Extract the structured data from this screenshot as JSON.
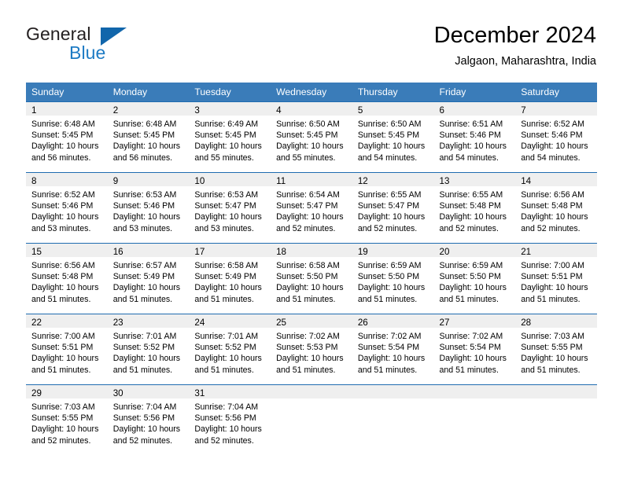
{
  "logo": {
    "word_one": "General",
    "word_two": "Blue",
    "mark": "triangle-logo-mark"
  },
  "header": {
    "title": "December 2024",
    "location": "Jalgaon, Maharashtra, India"
  },
  "colors": {
    "header_blue": "#3a7cb9",
    "row_rule_blue": "#1f6cb0",
    "daynum_band": "#efefef",
    "logo_blue": "#1e7bc4",
    "logo_dark": "#231f20"
  },
  "weekday_headers": [
    "Sunday",
    "Monday",
    "Tuesday",
    "Wednesday",
    "Thursday",
    "Friday",
    "Saturday"
  ],
  "weeks": [
    [
      {
        "day": "1",
        "sunrise": "Sunrise: 6:48 AM",
        "sunset": "Sunset: 5:45 PM",
        "daylight": "Daylight: 10 hours and 56 minutes."
      },
      {
        "day": "2",
        "sunrise": "Sunrise: 6:48 AM",
        "sunset": "Sunset: 5:45 PM",
        "daylight": "Daylight: 10 hours and 56 minutes."
      },
      {
        "day": "3",
        "sunrise": "Sunrise: 6:49 AM",
        "sunset": "Sunset: 5:45 PM",
        "daylight": "Daylight: 10 hours and 55 minutes."
      },
      {
        "day": "4",
        "sunrise": "Sunrise: 6:50 AM",
        "sunset": "Sunset: 5:45 PM",
        "daylight": "Daylight: 10 hours and 55 minutes."
      },
      {
        "day": "5",
        "sunrise": "Sunrise: 6:50 AM",
        "sunset": "Sunset: 5:45 PM",
        "daylight": "Daylight: 10 hours and 54 minutes."
      },
      {
        "day": "6",
        "sunrise": "Sunrise: 6:51 AM",
        "sunset": "Sunset: 5:46 PM",
        "daylight": "Daylight: 10 hours and 54 minutes."
      },
      {
        "day": "7",
        "sunrise": "Sunrise: 6:52 AM",
        "sunset": "Sunset: 5:46 PM",
        "daylight": "Daylight: 10 hours and 54 minutes."
      }
    ],
    [
      {
        "day": "8",
        "sunrise": "Sunrise: 6:52 AM",
        "sunset": "Sunset: 5:46 PM",
        "daylight": "Daylight: 10 hours and 53 minutes."
      },
      {
        "day": "9",
        "sunrise": "Sunrise: 6:53 AM",
        "sunset": "Sunset: 5:46 PM",
        "daylight": "Daylight: 10 hours and 53 minutes."
      },
      {
        "day": "10",
        "sunrise": "Sunrise: 6:53 AM",
        "sunset": "Sunset: 5:47 PM",
        "daylight": "Daylight: 10 hours and 53 minutes."
      },
      {
        "day": "11",
        "sunrise": "Sunrise: 6:54 AM",
        "sunset": "Sunset: 5:47 PM",
        "daylight": "Daylight: 10 hours and 52 minutes."
      },
      {
        "day": "12",
        "sunrise": "Sunrise: 6:55 AM",
        "sunset": "Sunset: 5:47 PM",
        "daylight": "Daylight: 10 hours and 52 minutes."
      },
      {
        "day": "13",
        "sunrise": "Sunrise: 6:55 AM",
        "sunset": "Sunset: 5:48 PM",
        "daylight": "Daylight: 10 hours and 52 minutes."
      },
      {
        "day": "14",
        "sunrise": "Sunrise: 6:56 AM",
        "sunset": "Sunset: 5:48 PM",
        "daylight": "Daylight: 10 hours and 52 minutes."
      }
    ],
    [
      {
        "day": "15",
        "sunrise": "Sunrise: 6:56 AM",
        "sunset": "Sunset: 5:48 PM",
        "daylight": "Daylight: 10 hours and 51 minutes."
      },
      {
        "day": "16",
        "sunrise": "Sunrise: 6:57 AM",
        "sunset": "Sunset: 5:49 PM",
        "daylight": "Daylight: 10 hours and 51 minutes."
      },
      {
        "day": "17",
        "sunrise": "Sunrise: 6:58 AM",
        "sunset": "Sunset: 5:49 PM",
        "daylight": "Daylight: 10 hours and 51 minutes."
      },
      {
        "day": "18",
        "sunrise": "Sunrise: 6:58 AM",
        "sunset": "Sunset: 5:50 PM",
        "daylight": "Daylight: 10 hours and 51 minutes."
      },
      {
        "day": "19",
        "sunrise": "Sunrise: 6:59 AM",
        "sunset": "Sunset: 5:50 PM",
        "daylight": "Daylight: 10 hours and 51 minutes."
      },
      {
        "day": "20",
        "sunrise": "Sunrise: 6:59 AM",
        "sunset": "Sunset: 5:50 PM",
        "daylight": "Daylight: 10 hours and 51 minutes."
      },
      {
        "day": "21",
        "sunrise": "Sunrise: 7:00 AM",
        "sunset": "Sunset: 5:51 PM",
        "daylight": "Daylight: 10 hours and 51 minutes."
      }
    ],
    [
      {
        "day": "22",
        "sunrise": "Sunrise: 7:00 AM",
        "sunset": "Sunset: 5:51 PM",
        "daylight": "Daylight: 10 hours and 51 minutes."
      },
      {
        "day": "23",
        "sunrise": "Sunrise: 7:01 AM",
        "sunset": "Sunset: 5:52 PM",
        "daylight": "Daylight: 10 hours and 51 minutes."
      },
      {
        "day": "24",
        "sunrise": "Sunrise: 7:01 AM",
        "sunset": "Sunset: 5:52 PM",
        "daylight": "Daylight: 10 hours and 51 minutes."
      },
      {
        "day": "25",
        "sunrise": "Sunrise: 7:02 AM",
        "sunset": "Sunset: 5:53 PM",
        "daylight": "Daylight: 10 hours and 51 minutes."
      },
      {
        "day": "26",
        "sunrise": "Sunrise: 7:02 AM",
        "sunset": "Sunset: 5:54 PM",
        "daylight": "Daylight: 10 hours and 51 minutes."
      },
      {
        "day": "27",
        "sunrise": "Sunrise: 7:02 AM",
        "sunset": "Sunset: 5:54 PM",
        "daylight": "Daylight: 10 hours and 51 minutes."
      },
      {
        "day": "28",
        "sunrise": "Sunrise: 7:03 AM",
        "sunset": "Sunset: 5:55 PM",
        "daylight": "Daylight: 10 hours and 51 minutes."
      }
    ],
    [
      {
        "day": "29",
        "sunrise": "Sunrise: 7:03 AM",
        "sunset": "Sunset: 5:55 PM",
        "daylight": "Daylight: 10 hours and 52 minutes."
      },
      {
        "day": "30",
        "sunrise": "Sunrise: 7:04 AM",
        "sunset": "Sunset: 5:56 PM",
        "daylight": "Daylight: 10 hours and 52 minutes."
      },
      {
        "day": "31",
        "sunrise": "Sunrise: 7:04 AM",
        "sunset": "Sunset: 5:56 PM",
        "daylight": "Daylight: 10 hours and 52 minutes."
      },
      {
        "day": "",
        "sunrise": "",
        "sunset": "",
        "daylight": ""
      },
      {
        "day": "",
        "sunrise": "",
        "sunset": "",
        "daylight": ""
      },
      {
        "day": "",
        "sunrise": "",
        "sunset": "",
        "daylight": ""
      },
      {
        "day": "",
        "sunrise": "",
        "sunset": "",
        "daylight": ""
      }
    ]
  ]
}
